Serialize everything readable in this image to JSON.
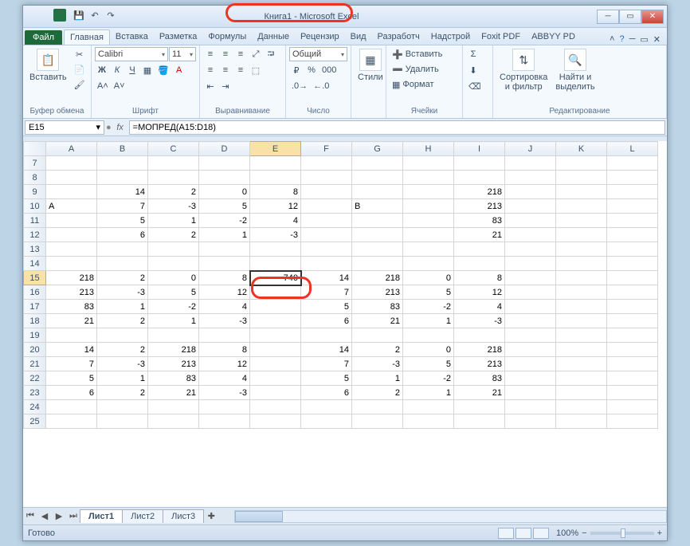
{
  "title": "Книга1 - Microsoft Excel",
  "qat": {
    "save": "💾",
    "undo": "↶",
    "redo": "↷"
  },
  "file_tab": "Файл",
  "tabs": [
    "Главная",
    "Вставка",
    "Разметка",
    "Формулы",
    "Данные",
    "Рецензир",
    "Вид",
    "Разработч",
    "Надстрой",
    "Foxit PDF",
    "ABBYY PD"
  ],
  "active_tab": 0,
  "ribbon": {
    "clipboard": {
      "paste": "Вставить",
      "label": "Буфер обмена"
    },
    "font": {
      "name": "Calibri",
      "size": "11",
      "bold": "Ж",
      "italic": "К",
      "underline": "Ч",
      "label": "Шрифт"
    },
    "align": {
      "label": "Выравнивание"
    },
    "number": {
      "format": "Общий",
      "label": "Число"
    },
    "styles": {
      "btn": "Стили"
    },
    "cells": {
      "insert": "Вставить",
      "delete": "Удалить",
      "format": "Формат",
      "label": "Ячейки"
    },
    "editing": {
      "sort": "Сортировка\nи фильтр",
      "find": "Найти и\nвыделить",
      "label": "Редактирование"
    }
  },
  "namebox": "E15",
  "formula": "=МОПРЕД(A15:D18)",
  "columns": [
    "A",
    "B",
    "C",
    "D",
    "E",
    "F",
    "G",
    "H",
    "I",
    "J",
    "K",
    "L"
  ],
  "rows": [
    {
      "n": 7,
      "c": {}
    },
    {
      "n": 8,
      "c": {}
    },
    {
      "n": 9,
      "c": {
        "B": "14",
        "C": "2",
        "D": "0",
        "E": "8",
        "I": "218"
      }
    },
    {
      "n": 10,
      "c": {
        "A": "A",
        "B": "7",
        "C": "-3",
        "D": "5",
        "E": "12",
        "G": "B",
        "I": "213"
      }
    },
    {
      "n": 11,
      "c": {
        "B": "5",
        "C": "1",
        "D": "-2",
        "E": "4",
        "I": "83"
      }
    },
    {
      "n": 12,
      "c": {
        "B": "6",
        "C": "2",
        "D": "1",
        "E": "-3",
        "I": "21"
      }
    },
    {
      "n": 13,
      "c": {}
    },
    {
      "n": 14,
      "c": {}
    },
    {
      "n": 15,
      "c": {
        "A": "218",
        "B": "2",
        "C": "0",
        "D": "8",
        "E": "-740",
        "F": "14",
        "G": "218",
        "H": "0",
        "I": "8"
      }
    },
    {
      "n": 16,
      "c": {
        "A": "213",
        "B": "-3",
        "C": "5",
        "D": "12",
        "F": "7",
        "G": "213",
        "H": "5",
        "I": "12"
      }
    },
    {
      "n": 17,
      "c": {
        "A": "83",
        "B": "1",
        "C": "-2",
        "D": "4",
        "F": "5",
        "G": "83",
        "H": "-2",
        "I": "4"
      }
    },
    {
      "n": 18,
      "c": {
        "A": "21",
        "B": "2",
        "C": "1",
        "D": "-3",
        "F": "6",
        "G": "21",
        "H": "1",
        "I": "-3"
      }
    },
    {
      "n": 19,
      "c": {}
    },
    {
      "n": 20,
      "c": {
        "A": "14",
        "B": "2",
        "C": "218",
        "D": "8",
        "F": "14",
        "G": "2",
        "H": "0",
        "I": "218"
      }
    },
    {
      "n": 21,
      "c": {
        "A": "7",
        "B": "-3",
        "C": "213",
        "D": "12",
        "F": "7",
        "G": "-3",
        "H": "5",
        "I": "213"
      }
    },
    {
      "n": 22,
      "c": {
        "A": "5",
        "B": "1",
        "C": "83",
        "D": "4",
        "F": "5",
        "G": "1",
        "H": "-2",
        "I": "83"
      }
    },
    {
      "n": 23,
      "c": {
        "A": "6",
        "B": "2",
        "C": "21",
        "D": "-3",
        "F": "6",
        "G": "2",
        "H": "1",
        "I": "21"
      }
    },
    {
      "n": 24,
      "c": {}
    },
    {
      "n": 25,
      "c": {}
    }
  ],
  "selected_cell": {
    "row": 15,
    "col": "E"
  },
  "text_left_cells": [
    "A10",
    "G10"
  ],
  "sheet_tabs": [
    "Лист1",
    "Лист2",
    "Лист3"
  ],
  "active_sheet": 0,
  "status": "Готово",
  "zoom": "100%"
}
